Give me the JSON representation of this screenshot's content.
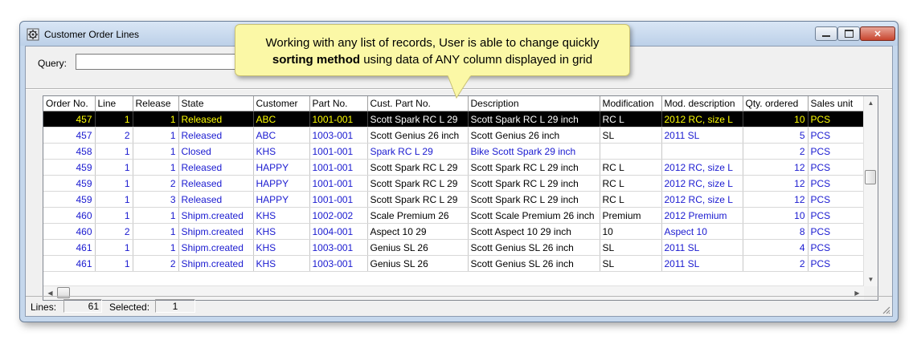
{
  "window": {
    "title": "Customer Order Lines"
  },
  "query": {
    "label": "Query:",
    "value": ""
  },
  "callout": {
    "line1": "Working with any list of records, User is able to change quickly",
    "bold": "sorting method",
    "line2_rest": " using data of ANY column displayed in grid"
  },
  "grid": {
    "columns": [
      "Order No.",
      "Line",
      "Release",
      "State",
      "Customer",
      "Part No.",
      "Cust. Part No.",
      "Description",
      "Modification",
      "Mod. description",
      "Qty. ordered",
      "Sales unit"
    ],
    "rows": [
      [
        "457",
        "1",
        "1",
        "Released",
        "ABC",
        "1001-001",
        "Scott Spark RC L 29",
        "Scott Spark RC L 29 inch",
        "RC L",
        "2012 RC, size L",
        "10",
        "PCS"
      ],
      [
        "457",
        "2",
        "1",
        "Released",
        "ABC",
        "1003-001",
        "Scott Genius 26 inch",
        "Scott Genius 26 inch",
        "SL",
        "2011 SL",
        "5",
        "PCS"
      ],
      [
        "458",
        "1",
        "1",
        "Closed",
        "KHS",
        "1001-001",
        "Spark RC L 29",
        "Bike Scott Spark 29 inch",
        "",
        "",
        "2",
        "PCS"
      ],
      [
        "459",
        "1",
        "1",
        "Released",
        "HAPPY",
        "1001-001",
        "Scott Spark RC L 29",
        "Scott Spark RC L 29 inch",
        "RC L",
        "2012 RC, size L",
        "12",
        "PCS"
      ],
      [
        "459",
        "1",
        "2",
        "Released",
        "HAPPY",
        "1001-001",
        "Scott Spark RC L 29",
        "Scott Spark RC L 29 inch",
        "RC L",
        "2012 RC, size L",
        "12",
        "PCS"
      ],
      [
        "459",
        "1",
        "3",
        "Released",
        "HAPPY",
        "1001-001",
        "Scott Spark RC L 29",
        "Scott Spark RC L 29 inch",
        "RC L",
        "2012 RC, size L",
        "12",
        "PCS"
      ],
      [
        "460",
        "1",
        "1",
        "Shipm.created",
        "KHS",
        "1002-002",
        "Scale Premium 26",
        "Scott Scale Premium 26 inch",
        "Premium",
        "2012 Premium",
        "10",
        "PCS"
      ],
      [
        "460",
        "2",
        "1",
        "Shipm.created",
        "KHS",
        "1004-001",
        "Aspect 10 29",
        "Scott Aspect 10 29 inch",
        "10",
        "Aspect 10",
        "8",
        "PCS"
      ],
      [
        "461",
        "1",
        "1",
        "Shipm.created",
        "KHS",
        "1003-001",
        "Genius SL 26",
        "Scott Genius SL 26 inch",
        "SL",
        "2011 SL",
        "4",
        "PCS"
      ],
      [
        "461",
        "1",
        "2",
        "Shipm.created",
        "KHS",
        "1003-001",
        "Genius SL 26",
        "Scott Genius SL 26 inch",
        "SL",
        "2011 SL",
        "2",
        "PCS"
      ]
    ],
    "black_cells": [
      [
        false,
        false,
        false,
        false,
        false,
        false,
        true,
        true,
        true,
        false,
        false,
        false
      ],
      [
        false,
        false,
        false,
        false,
        false,
        false,
        true,
        true,
        true,
        false,
        false,
        false
      ],
      [
        false,
        false,
        false,
        false,
        false,
        false,
        false,
        false,
        true,
        false,
        false,
        false
      ],
      [
        false,
        false,
        false,
        false,
        false,
        false,
        true,
        true,
        true,
        false,
        false,
        false
      ],
      [
        false,
        false,
        false,
        false,
        false,
        false,
        true,
        true,
        true,
        false,
        false,
        false
      ],
      [
        false,
        false,
        false,
        false,
        false,
        false,
        true,
        true,
        true,
        false,
        false,
        false
      ],
      [
        false,
        false,
        false,
        false,
        false,
        false,
        true,
        true,
        true,
        false,
        false,
        false
      ],
      [
        false,
        false,
        false,
        false,
        false,
        false,
        true,
        true,
        true,
        false,
        false,
        false
      ],
      [
        false,
        false,
        false,
        false,
        false,
        false,
        true,
        true,
        true,
        false,
        false,
        false
      ],
      [
        false,
        false,
        false,
        false,
        false,
        false,
        true,
        true,
        true,
        false,
        false,
        false
      ]
    ],
    "selected_row": 0
  },
  "status": {
    "lines_label": "Lines:",
    "lines_value": "61",
    "selected_label": "Selected:",
    "selected_value": "1"
  },
  "colors": {
    "data_text": "#1a1ad0",
    "selection_bg": "#000000",
    "selection_text": "#ffff00",
    "callout_bg": "#fbf8a6"
  },
  "icons": {
    "app": "app-gear-icon",
    "minimize": "minimize-icon",
    "maximize": "maximize-icon",
    "close": "close-icon",
    "scroll_up": "scroll-up-arrow-icon",
    "scroll_down": "scroll-down-arrow-icon",
    "scroll_left": "scroll-left-arrow-icon",
    "scroll_right": "scroll-right-arrow-icon",
    "resize": "resize-grip-icon"
  }
}
